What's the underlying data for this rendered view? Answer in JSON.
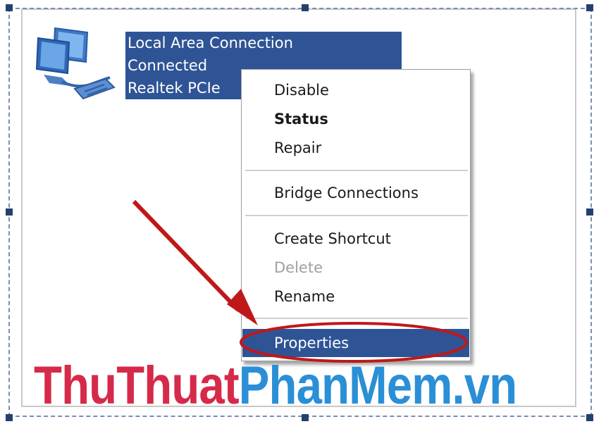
{
  "connection": {
    "name": "Local Area Connection",
    "status": "Connected",
    "adapter": "Realtek PCIe"
  },
  "context_menu": {
    "items": [
      {
        "label": "Disable",
        "style": "normal"
      },
      {
        "label": "Status",
        "style": "bold"
      },
      {
        "label": "Repair",
        "style": "normal"
      },
      {
        "label": "Bridge Connections",
        "style": "normal"
      },
      {
        "label": "Create Shortcut",
        "style": "normal"
      },
      {
        "label": "Delete",
        "style": "disabled"
      },
      {
        "label": "Rename",
        "style": "normal"
      },
      {
        "label": "Properties",
        "style": "highlighted"
      }
    ]
  },
  "icons": {
    "connection": "network-connection-icon"
  },
  "colors": {
    "selection": "#2f5496",
    "annotation": "#c01818",
    "watermark_part1": "#d62a4a",
    "watermark_part2": "#2a8fd6"
  },
  "watermark": {
    "part1": "ThuThuat",
    "part2": "PhanMem.vn"
  }
}
